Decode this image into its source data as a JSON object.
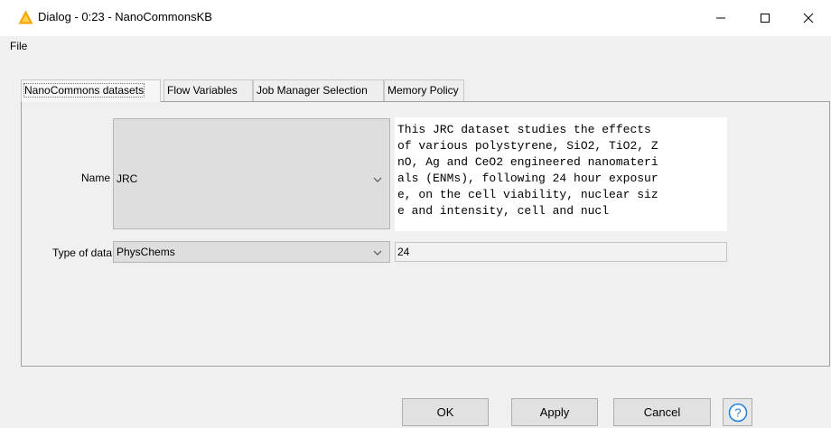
{
  "window": {
    "title": "Dialog - 0:23 - NanoCommonsKB",
    "icon": "warning-triangle-icon"
  },
  "menu": {
    "file": "File"
  },
  "tabs": [
    {
      "label": "NanoCommons datasets",
      "active": true
    },
    {
      "label": "Flow Variables",
      "active": false
    },
    {
      "label": "Job Manager Selection",
      "active": false
    },
    {
      "label": "Memory Policy",
      "active": false
    }
  ],
  "form": {
    "name_label": "Name",
    "name_value": "JRC",
    "type_label": "Type of data",
    "type_value": "PhysChems",
    "description": "This JRC dataset studies the effects\nof various polystyrene, SiO2, TiO2, Z\nnO, Ag and CeO2 engineered nanomateri\nals (ENMs), following 24 hour exposur\ne, on the cell viability, nuclear siz\ne and intensity, cell and nucl",
    "count_value": "24"
  },
  "buttons": {
    "ok": "OK",
    "apply": "Apply",
    "cancel": "Cancel",
    "help": "?"
  },
  "colors": {
    "icon_warning": "#f5a300",
    "help_blue": "#1e7fd8"
  }
}
